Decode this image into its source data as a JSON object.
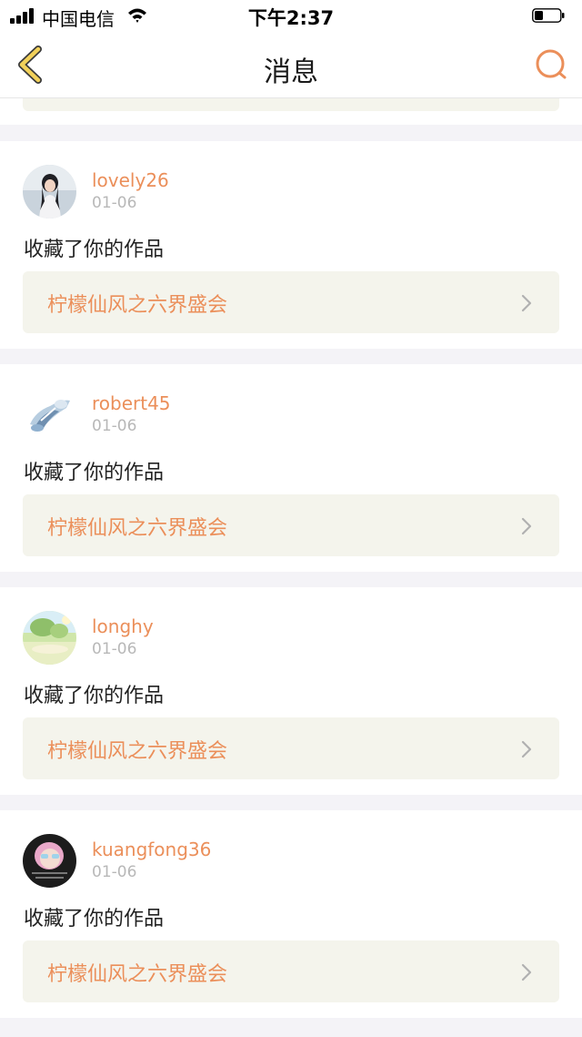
{
  "status_bar": {
    "carrier": "中国电信",
    "time": "下午2:37"
  },
  "nav": {
    "title": "消息",
    "back_icon": "chevron-left-icon",
    "search_icon": "search-icon"
  },
  "colors": {
    "accent": "#eb8f5a",
    "back_icon_fill": "#f2d15a",
    "card_link_bg": "#f4f4ec",
    "page_bg": "#f4f3f7"
  },
  "notifications": [
    {
      "username": "lovely26",
      "date": "01-06",
      "action": "收藏了你的作品",
      "work_title": "柠檬仙风之六界盛会"
    },
    {
      "username": "robert45",
      "date": "01-06",
      "action": "收藏了你的作品",
      "work_title": "柠檬仙风之六界盛会"
    },
    {
      "username": "longhy",
      "date": "01-06",
      "action": "收藏了你的作品",
      "work_title": "柠檬仙风之六界盛会"
    },
    {
      "username": "kuangfong36",
      "date": "01-06",
      "action": "收藏了你的作品",
      "work_title": "柠檬仙风之六界盛会"
    }
  ]
}
